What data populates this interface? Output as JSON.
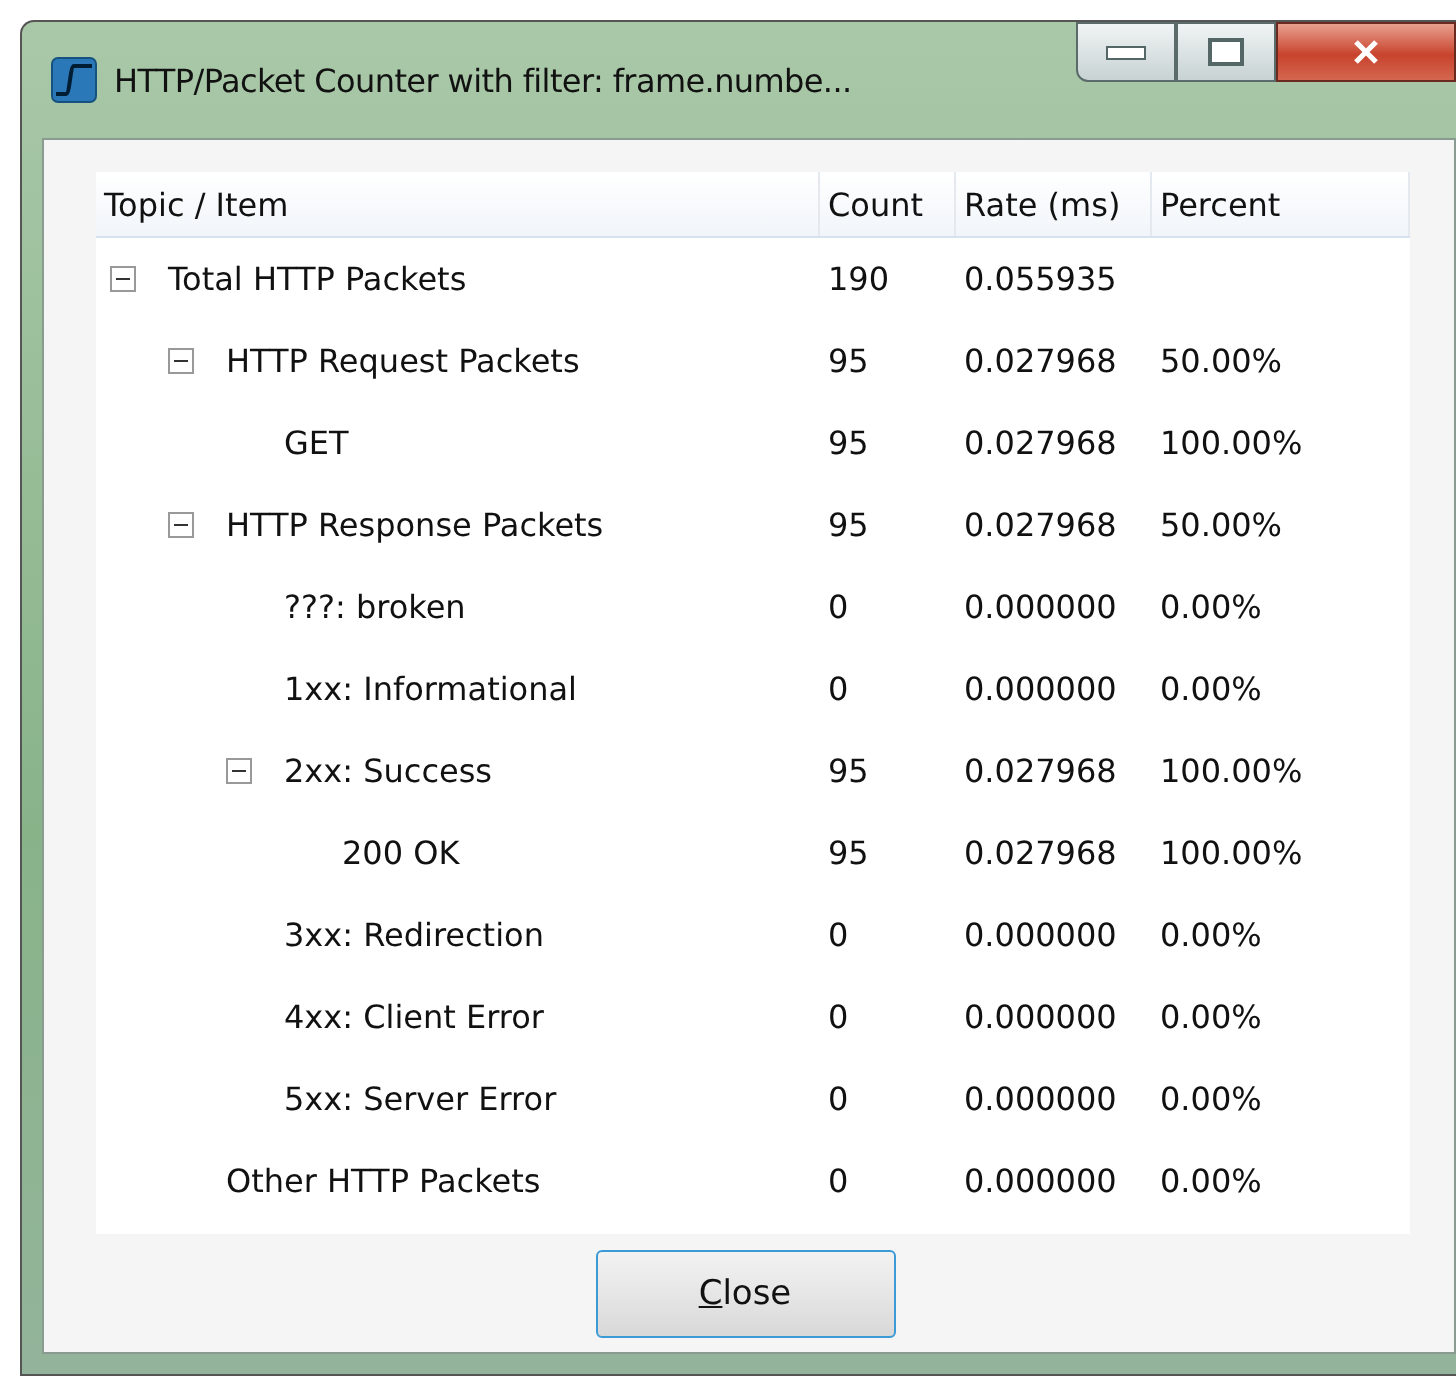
{
  "window": {
    "title": "HTTP/Packet Counter with filter: frame.numbe..."
  },
  "table": {
    "columns": [
      "Topic / Item",
      "Count",
      "Rate (ms)",
      "Percent"
    ],
    "rows": [
      {
        "topic": "Total HTTP Packets",
        "count": "190",
        "rate": "0.055935",
        "expanded": true,
        "children": [
          {
            "topic": "HTTP Request Packets",
            "count": "95",
            "rate": "0.027968",
            "percent": "50.00%",
            "expanded": true,
            "children": [
              {
                "topic": "GET",
                "count": "95",
                "rate": "0.027968",
                "percent": "100.00%"
              }
            ]
          },
          {
            "topic": "HTTP Response Packets",
            "count": "95",
            "rate": "0.027968",
            "percent": "50.00%",
            "expanded": true,
            "children": [
              {
                "topic": "???: broken",
                "count": "0",
                "rate": "0.000000",
                "percent": "0.00%"
              },
              {
                "topic": "1xx: Informational",
                "count": "0",
                "rate": "0.000000",
                "percent": "0.00%"
              },
              {
                "topic": "2xx: Success",
                "count": "95",
                "rate": "0.027968",
                "percent": "100.00%",
                "expanded": true,
                "children": [
                  {
                    "topic": "200 OK",
                    "count": "95",
                    "rate": "0.027968",
                    "percent": "100.00%"
                  }
                ]
              },
              {
                "topic": "3xx: Redirection",
                "count": "0",
                "rate": "0.000000",
                "percent": "0.00%"
              },
              {
                "topic": "4xx: Client Error",
                "count": "0",
                "rate": "0.000000",
                "percent": "0.00%"
              },
              {
                "topic": "5xx: Server Error",
                "count": "0",
                "rate": "0.000000",
                "percent": "0.00%"
              }
            ]
          },
          {
            "topic": "Other HTTP Packets",
            "count": "0",
            "rate": "0.000000",
            "percent": "0.00%"
          }
        ]
      }
    ]
  },
  "buttons": [
    {
      "label": "Close"
    }
  ]
}
